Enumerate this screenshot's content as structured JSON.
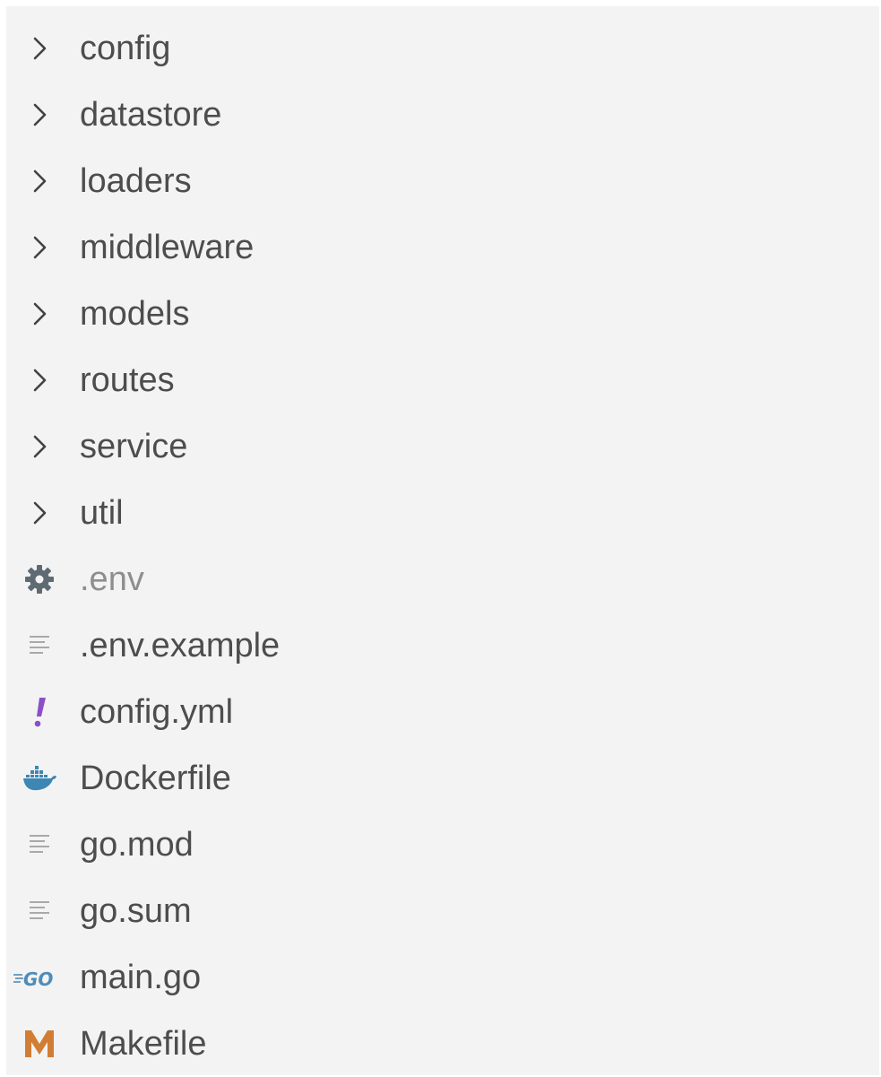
{
  "explorer": {
    "folders": [
      {
        "name": "config",
        "icon": "chevron-right-icon"
      },
      {
        "name": "datastore",
        "icon": "chevron-right-icon"
      },
      {
        "name": "loaders",
        "icon": "chevron-right-icon"
      },
      {
        "name": "middleware",
        "icon": "chevron-right-icon"
      },
      {
        "name": "models",
        "icon": "chevron-right-icon"
      },
      {
        "name": "routes",
        "icon": "chevron-right-icon"
      },
      {
        "name": "service",
        "icon": "chevron-right-icon"
      },
      {
        "name": "util",
        "icon": "chevron-right-icon"
      }
    ],
    "files": [
      {
        "name": ".env",
        "icon": "gear-icon",
        "dimmed": true
      },
      {
        "name": ".env.example",
        "icon": "text-file-icon",
        "dimmed": false
      },
      {
        "name": "config.yml",
        "icon": "yaml-exclamation-icon",
        "dimmed": false
      },
      {
        "name": "Dockerfile",
        "icon": "docker-whale-icon",
        "dimmed": false
      },
      {
        "name": "go.mod",
        "icon": "text-file-icon",
        "dimmed": false
      },
      {
        "name": "go.sum",
        "icon": "text-file-icon",
        "dimmed": false
      },
      {
        "name": "main.go",
        "icon": "go-icon",
        "dimmed": false
      },
      {
        "name": "Makefile",
        "icon": "makefile-m-icon",
        "dimmed": false
      }
    ],
    "colors": {
      "panel_background": "#f3f3f3",
      "label_text": "#4d4d4d",
      "dimmed_text": "#8e8e8e",
      "chevron": "#424242",
      "gear_icon": "#5f6b73",
      "text_file_icon": "#a9a9a9",
      "yaml_icon": "#8b4fc8",
      "docker_icon": "#3e86b4",
      "go_icon": "#4f8cb8",
      "makefile_icon": "#d27d34"
    }
  }
}
